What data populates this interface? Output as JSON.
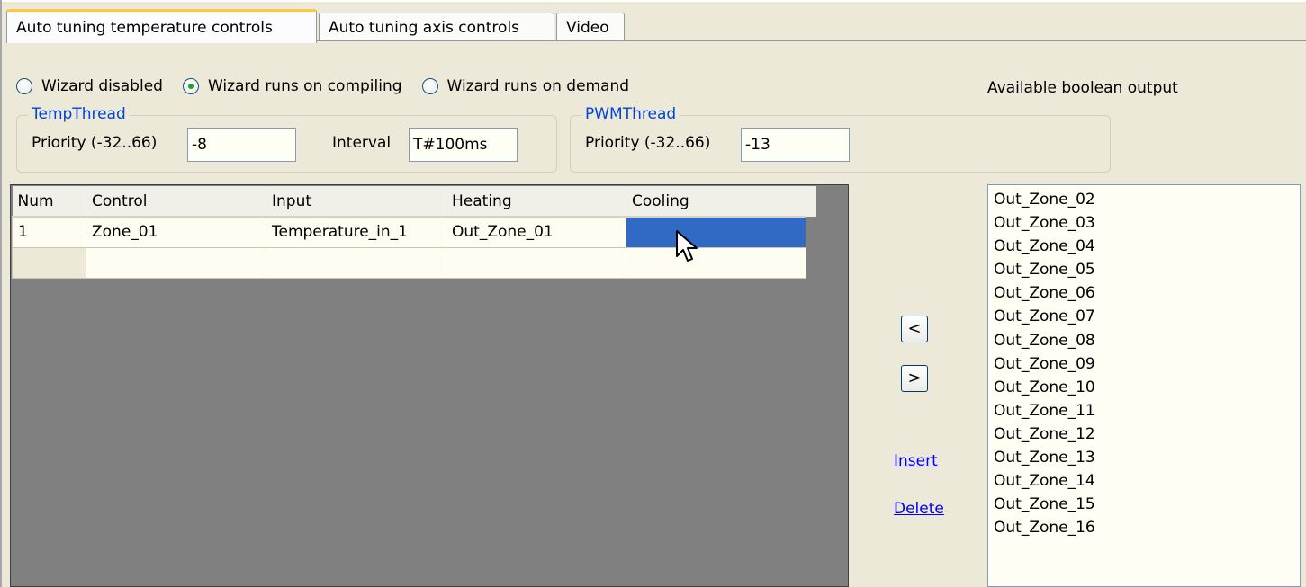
{
  "tabs": [
    {
      "label": "Auto tuning temperature controls",
      "active": true
    },
    {
      "label": "Auto tuning axis controls",
      "active": false
    },
    {
      "label": "Video",
      "active": false
    }
  ],
  "wizard": {
    "options": [
      "Wizard disabled",
      "Wizard runs on compiling",
      "Wizard runs on demand"
    ],
    "selected": "Wizard runs on compiling"
  },
  "temp_thread": {
    "title": "TempThread",
    "priority_label": "Priority (-32..66)",
    "priority_value": "-8",
    "interval_label": "Interval",
    "interval_value": "T#100ms"
  },
  "pwm_thread": {
    "title": "PWMThread",
    "priority_label": "Priority (-32..66)",
    "priority_value": "-13"
  },
  "grid": {
    "headers": [
      "Num",
      "Control",
      "Input",
      "Heating",
      "Cooling"
    ],
    "rows": [
      [
        "1",
        "Zone_01",
        "Temperature_in_1",
        "Out_Zone_01",
        ""
      ]
    ]
  },
  "buttons": {
    "move_left": "<",
    "move_right": ">"
  },
  "links": {
    "insert": "Insert",
    "delete": "Delete"
  },
  "available": {
    "label": "Available boolean output",
    "items": [
      "Out_Zone_02",
      "Out_Zone_03",
      "Out_Zone_04",
      "Out_Zone_05",
      "Out_Zone_06",
      "Out_Zone_07",
      "Out_Zone_08",
      "Out_Zone_09",
      "Out_Zone_10",
      "Out_Zone_11",
      "Out_Zone_12",
      "Out_Zone_13",
      "Out_Zone_14",
      "Out_Zone_15",
      "Out_Zone_16"
    ]
  },
  "colors": {
    "background": "#ece9d8",
    "selection": "#316ac5",
    "link": "#0000ff",
    "group_title": "#0046d5"
  }
}
